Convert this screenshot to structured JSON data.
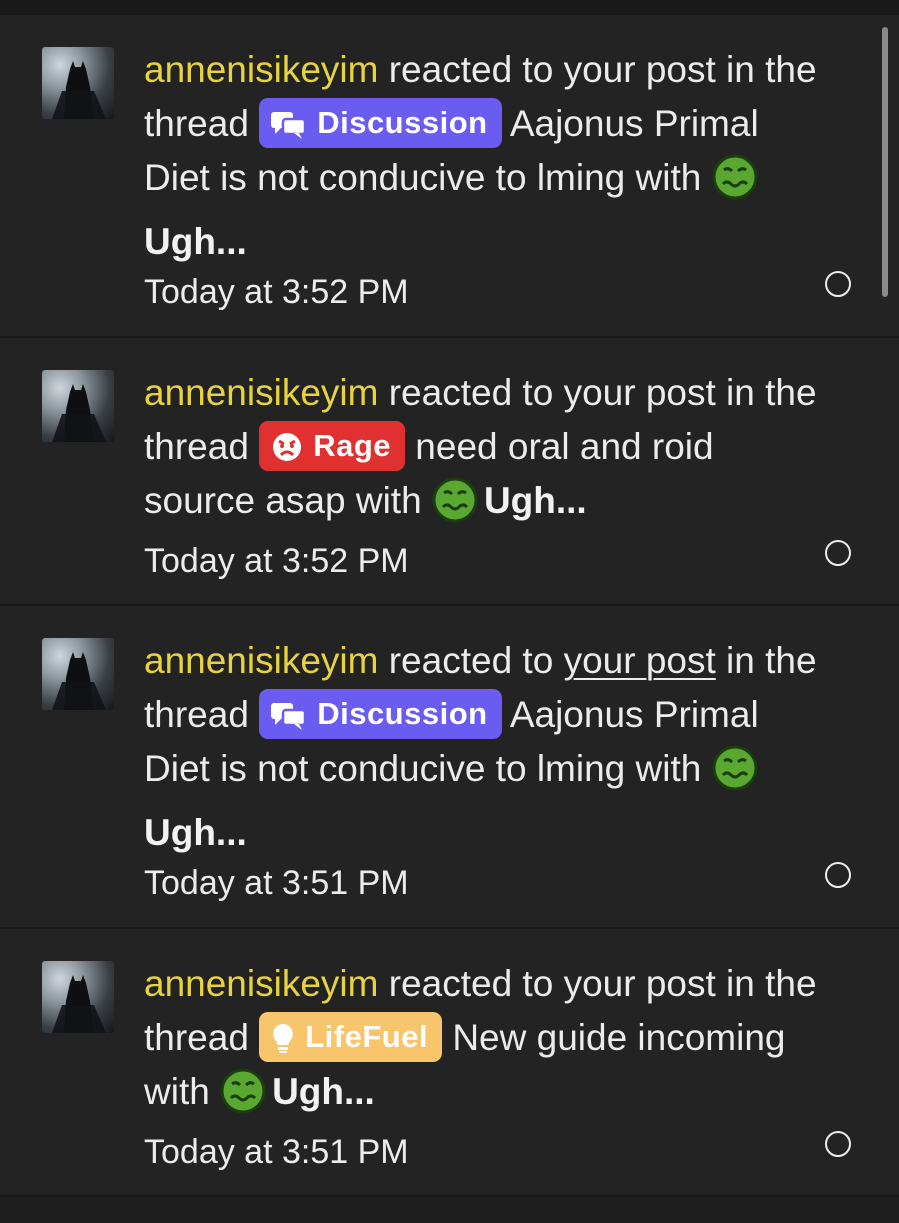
{
  "colors": {
    "username": "#e7d23f",
    "discussion_badge": "#6a5cf0",
    "rage_badge": "#e0302f",
    "lifefuel_badge": "#f8c46c",
    "emoji_green": "#5aa832",
    "background": "#232323"
  },
  "notifications": [
    {
      "username": "annenisikeyim",
      "text_pre": " reacted to ",
      "post_link": "your post",
      "text_mid": " in the thread ",
      "badge": {
        "label": "Discussion",
        "icon": "chat-bubbles-icon",
        "color": "#6a5cf0"
      },
      "thread_title": " Aajonus Primal Diet is not conducive to lming with ",
      "reaction_label": "Ugh...",
      "timestamp": "Today at 3:52 PM",
      "post_link_underlined": false
    },
    {
      "username": "annenisikeyim",
      "text_pre": " reacted to ",
      "post_link": "your post",
      "text_mid": " in the thread ",
      "badge": {
        "label": "Rage",
        "icon": "angry-face-icon",
        "color": "#e0302f"
      },
      "thread_title": " need oral and roid source asap with ",
      "reaction_label": "Ugh...",
      "timestamp": "Today at 3:52 PM",
      "post_link_underlined": false
    },
    {
      "username": "annenisikeyim",
      "text_pre": " reacted to ",
      "post_link": "your post",
      "text_mid": " in the thread ",
      "badge": {
        "label": "Discussion",
        "icon": "chat-bubbles-icon",
        "color": "#6a5cf0"
      },
      "thread_title": " Aajonus Primal Diet is not conducive to lming with ",
      "reaction_label": "Ugh...",
      "timestamp": "Today at 3:51 PM",
      "post_link_underlined": true
    },
    {
      "username": "annenisikeyim",
      "text_pre": " reacted to ",
      "post_link": "your post",
      "text_mid": " in the thread ",
      "badge": {
        "label": "LifeFuel",
        "icon": "lightbulb-icon",
        "color": "#f8c46c"
      },
      "thread_title": " New guide incoming with ",
      "reaction_label": "Ugh...",
      "timestamp": "Today at 3:51 PM",
      "post_link_underlined": false
    }
  ]
}
